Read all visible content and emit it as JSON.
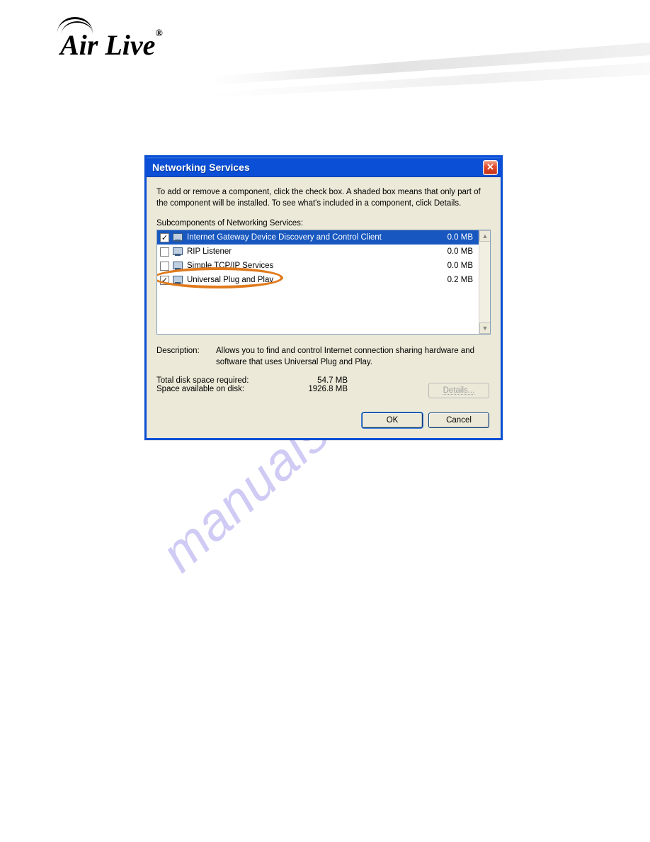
{
  "brand": "Air Live",
  "watermark": "manualshive.com",
  "dialog": {
    "title": "Networking Services",
    "instructions": "To add or remove a component, click the check box. A shaded box means that only part of the component will be installed. To see what's included in a component, click Details.",
    "subcomponents_label": "Subcomponents of Networking Services:",
    "items": [
      {
        "checked": true,
        "name": "Internet Gateway Device Discovery and Control Client",
        "size": "0.0 MB",
        "selected": true,
        "circled": false
      },
      {
        "checked": false,
        "name": "RIP Listener",
        "size": "0.0 MB",
        "selected": false,
        "circled": false
      },
      {
        "checked": false,
        "name": "Simple TCP/IP Services",
        "size": "0.0 MB",
        "selected": false,
        "circled": false
      },
      {
        "checked": true,
        "name": "Universal Plug and Play",
        "size": "0.2 MB",
        "selected": false,
        "circled": true
      }
    ],
    "description_label": "Description:",
    "description_text": "Allows you to find and control Internet connection sharing hardware and software that uses Universal Plug and Play.",
    "total_space_label": "Total disk space required:",
    "total_space_value": "54.7 MB",
    "avail_space_label": "Space available on disk:",
    "avail_space_value": "1926.8 MB",
    "details_button": "Details...",
    "ok_button": "OK",
    "cancel_button": "Cancel"
  }
}
